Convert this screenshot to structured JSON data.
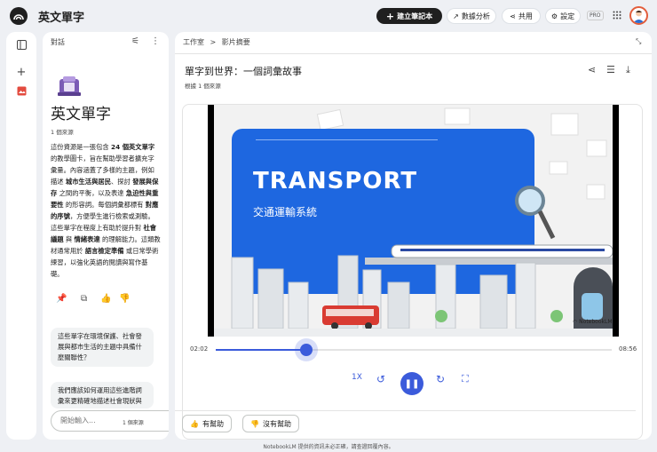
{
  "app": {
    "title": "英文單字"
  },
  "header": {
    "create_label": "建立筆記本",
    "analytics_label": "數據分析",
    "share_label": "共用",
    "settings_label": "設定",
    "pro_badge": "PRO"
  },
  "chat": {
    "heading": "對話",
    "notebook_title": "英文單字",
    "sources_count": "1 個來源",
    "summary": [
      {
        "t": "這份資源是一張包含 "
      },
      {
        "t": "24 個英文單字",
        "b": true
      },
      {
        "t": " 的教學圖卡，旨在幫助學習者擴充字彙量。內容涵蓋了多樣的主題，例如描述 "
      },
      {
        "t": "城市生活與居民",
        "b": true
      },
      {
        "t": "、探討 "
      },
      {
        "t": "發展與保存",
        "b": true
      },
      {
        "t": " 之間的平衡，以及表達 "
      },
      {
        "t": "急迫性與重要性",
        "b": true
      },
      {
        "t": " 的形容詞。每個詞彙都標有 "
      },
      {
        "t": "對應的序號",
        "b": true
      },
      {
        "t": "，方便學生進行檢索或測驗。這些單字在程度上有助於提升對 "
      },
      {
        "t": "社會議題",
        "b": true
      },
      {
        "t": " 與 "
      },
      {
        "t": "情緒表達",
        "b": true
      },
      {
        "t": " 的理解能力。這類教材通常用於 "
      },
      {
        "t": "語言檢定準備",
        "b": true
      },
      {
        "t": " 或日常學術練習，以強化英語的閱讀與寫作基礎。"
      }
    ],
    "suggestions": [
      "這些單字在環境保護、社會發展與都市生活的主題中具備什麼關聯性？",
      "我們應該如何運用這些進階詞彙來更精確地描述社會現狀與"
    ],
    "input_placeholder": "開始輸入...",
    "input_sources": "1 個來源"
  },
  "studio": {
    "breadcrumb_root": "工作室",
    "breadcrumb_sep": ">",
    "breadcrumb_current": "影片摘要",
    "video_title": "單字到世界：一個詞彙故事",
    "video_sub": "根據 1 個來源",
    "slide_title": "TRANSPORT",
    "slide_subtitle": "交通運輸系統",
    "watermark": "NotebookLM",
    "time_current": "02:02",
    "time_total": "08:56",
    "progress": 0.228,
    "speed_label": "1X",
    "helpful_label": "有幫助",
    "not_helpful_label": "沒有幫助"
  },
  "footer": {
    "disclaimer": "NotebookLM 提供的資訊未必正確，請查證回覆內容。"
  },
  "colors": {
    "accent": "#3b5bdb",
    "slide_blue": "#1e67e0",
    "bus_red": "#d93b32"
  }
}
